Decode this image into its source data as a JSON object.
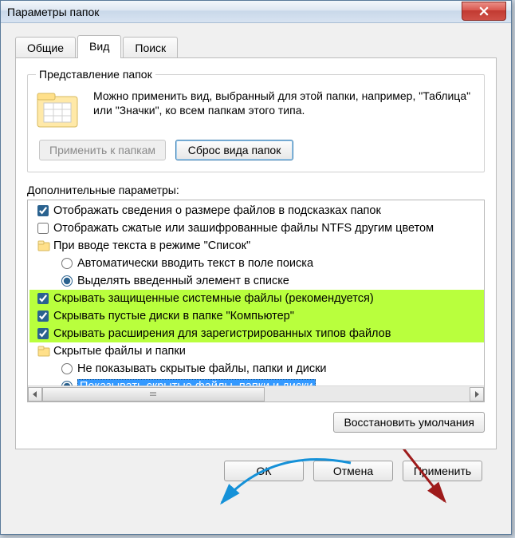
{
  "window": {
    "title": "Параметры папок"
  },
  "tabs": {
    "general": "Общие",
    "view": "Вид",
    "search": "Поиск"
  },
  "folderViews": {
    "legend": "Представление папок",
    "text": "Можно применить вид, выбранный для этой папки, например, \"Таблица\" или \"Значки\", ко всем папкам этого типа.",
    "applyBtn": "Применить к папкам",
    "resetBtn": "Сброс вида папок"
  },
  "advanced": {
    "label": "Дополнительные параметры:",
    "items": [
      {
        "type": "check",
        "checked": true,
        "text": "Отображать сведения о размере файлов в подсказках папок"
      },
      {
        "type": "check",
        "checked": false,
        "text": "Отображать сжатые или зашифрованные файлы NTFS другим цветом"
      },
      {
        "type": "folder",
        "text": "При вводе текста в режиме \"Список\""
      },
      {
        "type": "radio",
        "group": "g1",
        "checked": false,
        "text": "Автоматически вводить текст в поле поиска"
      },
      {
        "type": "radio",
        "group": "g1",
        "checked": true,
        "text": "Выделять введенный элемент в списке"
      },
      {
        "type": "check",
        "checked": true,
        "hl": true,
        "text": "Скрывать защищенные системные файлы (рекомендуется)"
      },
      {
        "type": "check",
        "checked": true,
        "hl": true,
        "text": "Скрывать пустые диски в папке \"Компьютер\""
      },
      {
        "type": "check",
        "checked": true,
        "hl": true,
        "text": "Скрывать расширения для зарегистрированных типов файлов"
      },
      {
        "type": "folder",
        "text": "Скрытые файлы и папки"
      },
      {
        "type": "radio",
        "group": "g2",
        "checked": false,
        "text": "Не показывать скрытые файлы, папки и диски"
      },
      {
        "type": "radio",
        "group": "g2",
        "checked": true,
        "sel": true,
        "text": "Показывать скрытые файлы, папки и диски"
      }
    ],
    "restoreBtn": "Восстановить умолчания"
  },
  "buttons": {
    "ok": "ОК",
    "cancel": "Отмена",
    "apply": "Применить"
  }
}
